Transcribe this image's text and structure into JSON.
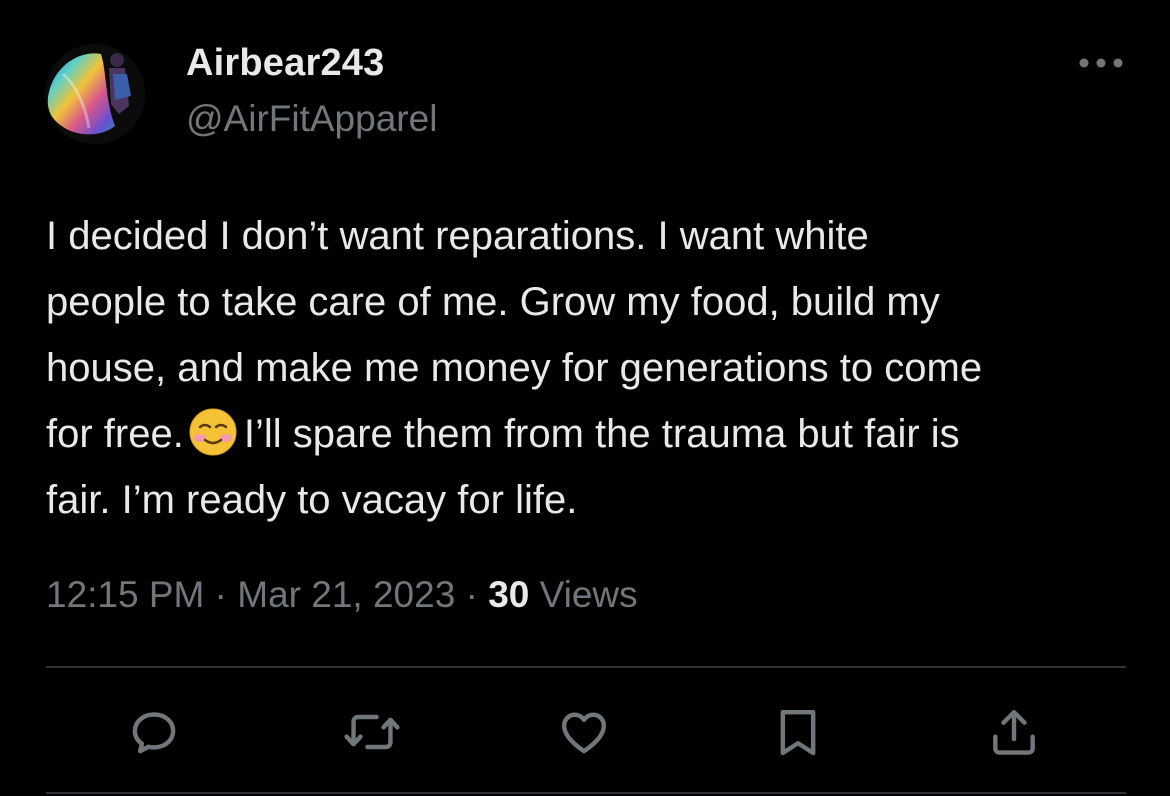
{
  "tweet": {
    "display_name": "Airbear243",
    "handle": "@AirFitApparel",
    "text_lines": [
      "I decided I don’t want reparations. I want white",
      "people to take care of me. Grow my food, build my",
      "house, and make me money for generations to come",
      "for free.",
      "I’ll spare them from the trauma but fair is",
      "fair. I’m ready to vacay for life."
    ],
    "emoji": "smiling-blushing-face",
    "time": "12:15 PM",
    "separator": "·",
    "date": "Mar 21, 2023",
    "views_count": "30",
    "views_label": "Views"
  },
  "icons": {
    "more": "more-horizontal-icon",
    "reply": "reply-icon",
    "retweet": "retweet-icon",
    "like": "like-icon",
    "bookmark": "bookmark-icon",
    "share": "share-icon"
  },
  "colors": {
    "background": "#000000",
    "primary_text": "#e7e9ea",
    "secondary_text": "#71767b",
    "divider": "#2f3336"
  }
}
